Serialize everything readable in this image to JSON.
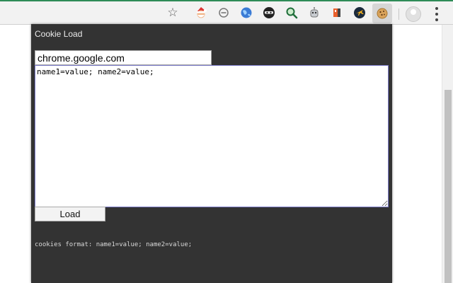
{
  "browser": {
    "accent_color": "#2e8b57",
    "toolbar_color": "#f2f2f2",
    "icons": [
      "star-icon",
      "santa-icon",
      "minus-circle-icon",
      "globe-icon",
      "incognito-icon",
      "magnifier-icon",
      "robot-icon",
      "puzzle-icon",
      "plane-icon",
      "cookie-icon",
      "profile-icon",
      "menu-icon"
    ]
  },
  "popup": {
    "title": "Cookie Load",
    "background": "#333333",
    "domain_value": "chrome.google.com",
    "cookies_value": "name1=value; name2=value;",
    "load_label": "Load",
    "hint": "cookies format: name1=value; name2=value;"
  }
}
